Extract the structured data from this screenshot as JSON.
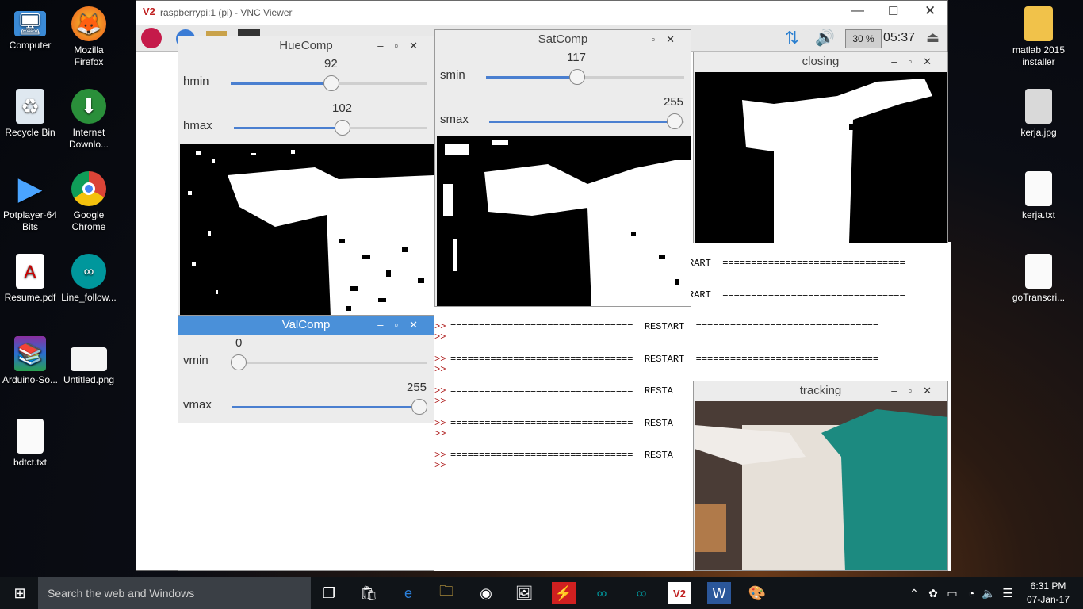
{
  "desktop_icons": [
    {
      "label": "Computer",
      "icon": "computer-icon"
    },
    {
      "label": "Mozilla\nFirefox",
      "icon": "firefox-icon"
    },
    {
      "label": "Recycle Bin",
      "icon": "recycle-bin-icon"
    },
    {
      "label": "Internet\nDownlo...",
      "icon": "internet-download-manager-icon"
    },
    {
      "label": "Potplayer-64\nBits",
      "icon": "potplayer-icon"
    },
    {
      "label": "Google\nChrome",
      "icon": "chrome-icon"
    },
    {
      "label": "Resume.pdf",
      "icon": "pdf-icon"
    },
    {
      "label": "Line_follow...",
      "icon": "arduino-icon"
    },
    {
      "label": "Arduino-So...",
      "icon": "winrar-icon"
    },
    {
      "label": "Untitled.png",
      "icon": "image-icon"
    },
    {
      "label": "bdtct.txt",
      "icon": "text-file-icon"
    },
    {
      "label": "matlab 2015\ninstaller",
      "icon": "folder-icon"
    },
    {
      "label": "kerja.jpg",
      "icon": "image-icon"
    },
    {
      "label": "kerja.txt",
      "icon": "text-file-icon"
    },
    {
      "label": "goTranscri...",
      "icon": "text-file-icon"
    }
  ],
  "vnc": {
    "title": "raspberrypi:1 (pi) - VNC Viewer",
    "panel_volume": "30 %",
    "panel_clock": "05:37"
  },
  "hue": {
    "title": "HueComp",
    "min_label": "hmin",
    "min_value": "92",
    "max_label": "hmax",
    "max_value": "102",
    "min_fraction": 0.36,
    "max_fraction": 0.4
  },
  "sat": {
    "title": "SatComp",
    "min_label": "smin",
    "min_value": "117",
    "max_label": "smax",
    "max_value": "255",
    "min_fraction": 0.46,
    "max_fraction": 1.0
  },
  "val": {
    "title": "ValComp",
    "min_label": "vmin",
    "min_value": "0",
    "max_label": "vmax",
    "max_value": "255",
    "min_fraction": 0.0,
    "max_fraction": 1.0
  },
  "closing": {
    "title": "closing"
  },
  "tracking": {
    "title": "tracking"
  },
  "terminal": {
    "prompt": ">>",
    "lines": [
      "RART  ================================",
      "RART  ================================",
      "================================  RESTART  ================================",
      "================================  RESTART  ================================",
      "================================  RESTA",
      "================================  RESTA",
      "================================  RESTA"
    ]
  },
  "taskbar": {
    "search_placeholder": "Search the web and Windows",
    "time": "6:31 PM",
    "date": "07-Jan-17"
  }
}
